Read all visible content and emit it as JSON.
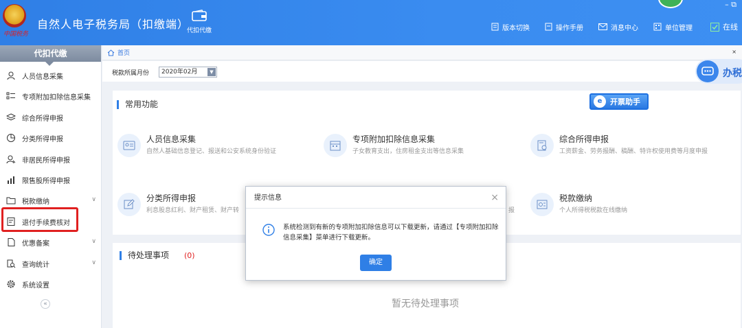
{
  "header": {
    "emblem_text": "中国税务",
    "title": "自然人电子税务局（扣缴端）",
    "module_tab": "代扣代缴",
    "links": [
      "版本切换",
      "操作手册",
      "消息中心",
      "单位管理"
    ],
    "online": "在线",
    "window_controls": "– ⧉"
  },
  "sidebar": {
    "header": "代扣代缴",
    "items": [
      {
        "label": "人员信息采集",
        "icon": "person-icon"
      },
      {
        "label": "专项附加扣除信息采集",
        "icon": "list-icon"
      },
      {
        "label": "综合所得申报",
        "icon": "layers-icon"
      },
      {
        "label": "分类所得申报",
        "icon": "pie-icon"
      },
      {
        "label": "非居民所得申报",
        "icon": "person-outline-icon"
      },
      {
        "label": "限售股所得申报",
        "icon": "bar-chart-icon"
      },
      {
        "label": "税款缴纳",
        "icon": "folder-icon"
      },
      {
        "label": "退付手续费核对",
        "icon": "receipt-icon"
      },
      {
        "label": "优惠备案",
        "icon": "document-icon"
      },
      {
        "label": "查询统计",
        "icon": "search-doc-icon"
      },
      {
        "label": "系统设置",
        "icon": "gear-icon"
      }
    ],
    "collapse": "«"
  },
  "breadcrumb": {
    "home": "首页",
    "close": "×"
  },
  "period": {
    "label": "税款所属月份",
    "value": "2020年02月"
  },
  "banshui": "办税",
  "common": {
    "title": "常用功能",
    "kaipiao": "开票助手",
    "cards": [
      {
        "title": "人员信息采集",
        "desc": "自然人基础信息登记、报送和公安系统身份验证"
      },
      {
        "title": "专项附加扣除信息采集",
        "desc": "子女教育支出，住房租金支出等信息采集"
      },
      {
        "title": "综合所得申报",
        "desc": "工资薪金、劳务报酬、稿酬、特许权使用费等月度申报"
      },
      {
        "title": "分类所得申报",
        "desc": "利息股息红利、财产租赁、财产转"
      },
      {
        "title": "税款缴纳",
        "desc": "个人所得税税款在线缴纳"
      }
    ],
    "partial_hidden_desc": "报"
  },
  "pending": {
    "title": "待处理事项",
    "count": "(0)",
    "empty": "暂无待处理事项"
  },
  "modal": {
    "title": "提示信息",
    "message": "系统检测到有新的专项附加扣除信息可以下载更新，请通过【专项附加扣除信息采集】菜单进行下载更新。",
    "ok": "确定",
    "close": "×"
  },
  "colors": {
    "primary": "#2f7fe6",
    "highlight": "#e02020"
  }
}
